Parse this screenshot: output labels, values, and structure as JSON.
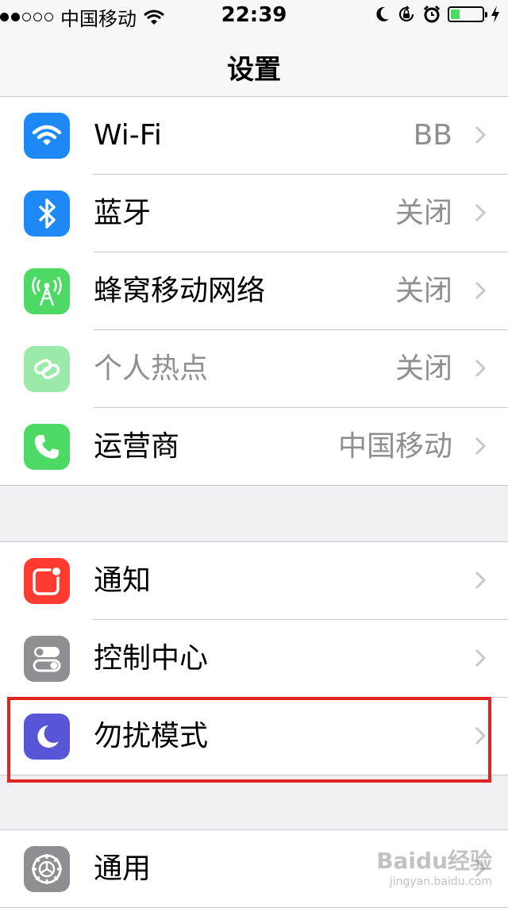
{
  "status_bar": {
    "carrier": "中国移动",
    "time": "22:39",
    "battery_level": 0.3,
    "signal_bars_filled": 2,
    "signal_bars_total": 5
  },
  "nav": {
    "title": "设置"
  },
  "colors": {
    "wifi": "#1e88f5",
    "bluetooth": "#1e88f5",
    "cellular": "#4cd964",
    "hotspot": "#4cd964",
    "carrier": "#4cd964",
    "notifications": "#ff3b30",
    "control_center": "#8e8e93",
    "dnd": "#5856d6",
    "general": "#8e8e93",
    "highlight": "#e02323"
  },
  "groups": [
    {
      "rows": [
        {
          "label": "Wi-Fi",
          "value": "BB",
          "icon": "wifi-icon"
        },
        {
          "label": "蓝牙",
          "value": "关闭",
          "icon": "bluetooth-icon"
        },
        {
          "label": "蜂窝移动网络",
          "value": "关闭",
          "icon": "cellular-icon"
        },
        {
          "label": "个人热点",
          "value": "关闭",
          "icon": "hotspot-icon",
          "disabled": true
        },
        {
          "label": "运营商",
          "value": "中国移动",
          "icon": "phone-icon"
        }
      ]
    },
    {
      "rows": [
        {
          "label": "通知",
          "value": "",
          "icon": "notifications-icon"
        },
        {
          "label": "控制中心",
          "value": "",
          "icon": "control-center-icon"
        },
        {
          "label": "勿扰模式",
          "value": "",
          "icon": "moon-icon"
        }
      ]
    },
    {
      "rows": [
        {
          "label": "通用",
          "value": "",
          "icon": "gear-icon"
        }
      ]
    }
  ],
  "watermark": {
    "brand": "Baidu经验",
    "url": "jingyan.baidu.com"
  }
}
